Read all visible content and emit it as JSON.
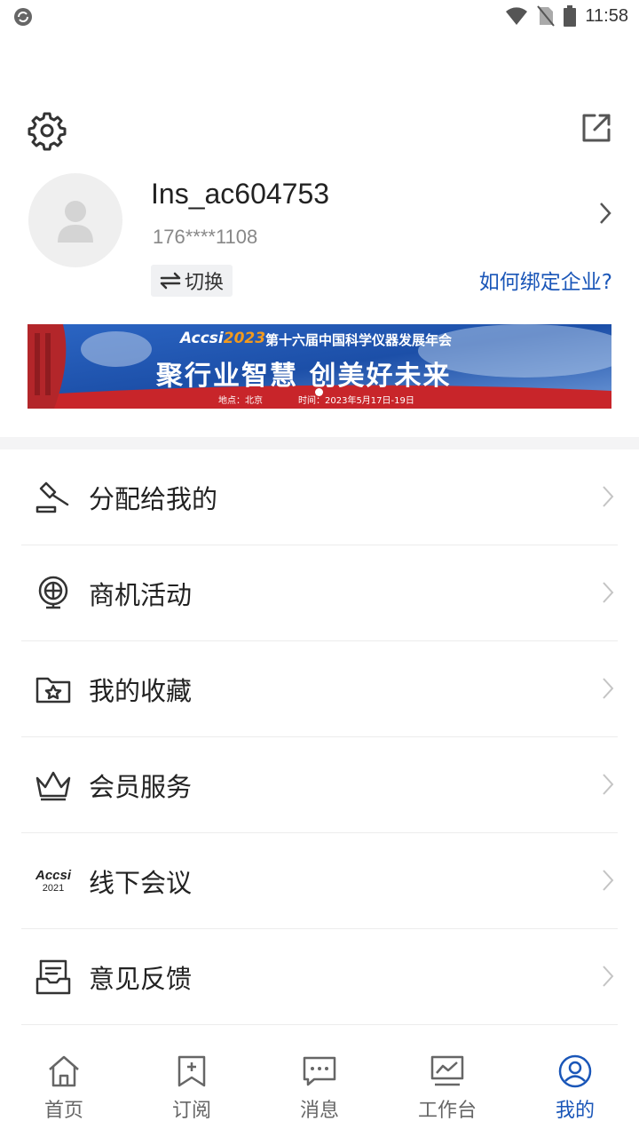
{
  "status_bar": {
    "time": "11:58"
  },
  "profile": {
    "username": "Ins_ac604753",
    "phone": "176****1108",
    "switch_label": "切换",
    "bind_link": "如何绑定企业?"
  },
  "banner": {
    "logo_text": "Accsi",
    "logo_year": "2023",
    "headline": "第十六届中国科学仪器发展年会",
    "slogan": "聚行业智慧 创美好未来",
    "location": "地点：北京",
    "time": "时间：2023年5月17日-19日"
  },
  "menu": {
    "items": [
      {
        "label": "分配给我的",
        "icon": "gavel-icon"
      },
      {
        "label": "商机活动",
        "icon": "globe-icon"
      },
      {
        "label": "我的收藏",
        "icon": "star-folder-icon"
      },
      {
        "label": "会员服务",
        "icon": "crown-icon"
      },
      {
        "label": "线下会议",
        "icon": "accsi-logo-icon",
        "icon_text": "Accsi",
        "icon_year": "2021"
      },
      {
        "label": "意见反馈",
        "icon": "feedback-icon"
      }
    ]
  },
  "tabs": [
    {
      "label": "首页",
      "icon": "home-icon"
    },
    {
      "label": "订阅",
      "icon": "bookmark-add-icon"
    },
    {
      "label": "消息",
      "icon": "chat-icon"
    },
    {
      "label": "工作台",
      "icon": "monitor-chart-icon"
    },
    {
      "label": "我的",
      "icon": "user-circle-icon",
      "active": true
    }
  ],
  "colors": {
    "accent": "#1a56b8",
    "text": "#222222",
    "muted": "#888888",
    "banner_blue": "#1c4fa8",
    "banner_red": "#c8252a"
  }
}
